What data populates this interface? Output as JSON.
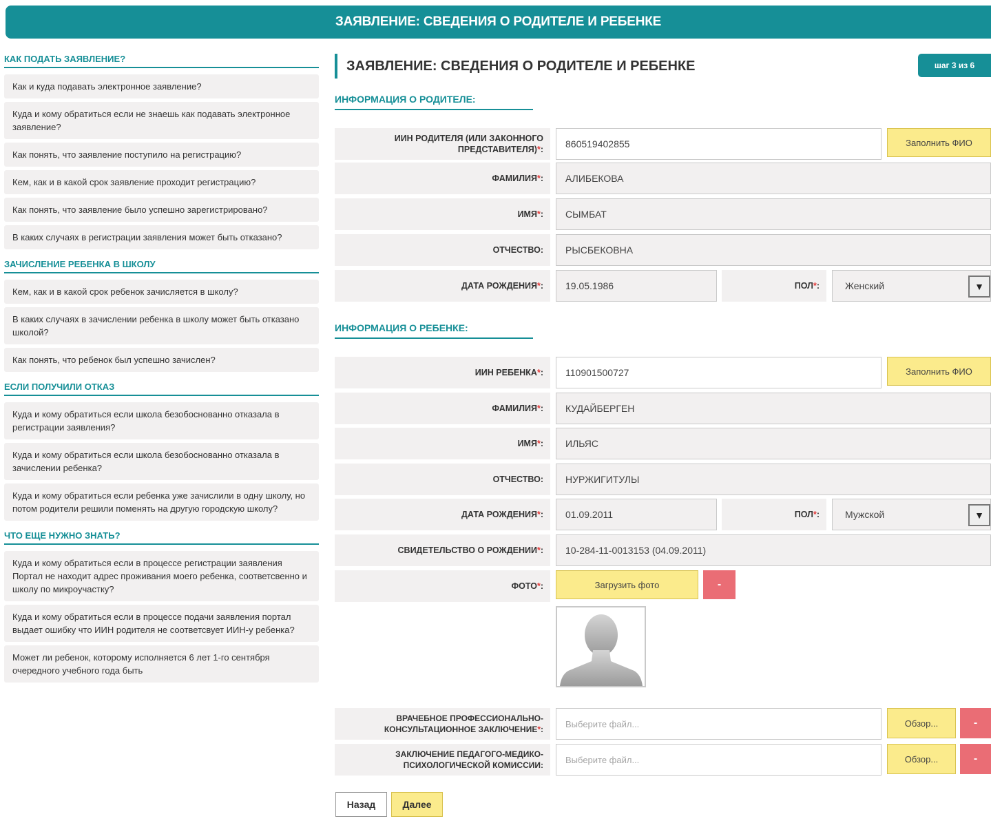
{
  "header": {
    "title": "ЗАЯВЛЕНИЕ: СВЕДЕНИЯ О РОДИТЕЛЕ И РЕБЕНКЕ"
  },
  "sidebar": {
    "sections": [
      {
        "title": "КАК ПОДАТЬ ЗАЯВЛЕНИЕ?",
        "items": [
          "Как и куда подавать электронное заявление?",
          "Куда и кому обратиться если не знаешь как подавать электронное заявление?",
          "Как понять, что заявление поступило на регистрацию?",
          "Кем, как и в какой срок заявление проходит регистрацию?",
          "Как понять, что заявление было успешно зарегистрировано?",
          "В каких случаях в регистрации заявления может быть отказано?"
        ]
      },
      {
        "title": "ЗАЧИСЛЕНИЕ РЕБЕНКА В ШКОЛУ",
        "items": [
          "Кем, как и в какой срок ребенок зачисляется в школу?",
          "В каких случаях в зачислении ребенка в школу может быть отказано школой?",
          "Как понять, что ребенок был успешно зачислен?"
        ]
      },
      {
        "title": "ЕСЛИ ПОЛУЧИЛИ ОТКАЗ",
        "items": [
          "Куда и кому обратиться если школа безобоснованно отказала в регистрации заявления?",
          "Куда и кому обратиться если школа безобоснованно отказала в зачислении ребенка?",
          "Куда и кому обратиться если ребенка уже зачислили в одну школу, но потом родители решили поменять на другую городскую школу?"
        ]
      },
      {
        "title": "ЧТО ЕЩЕ НУЖНО ЗНАТЬ?",
        "items": [
          "Куда и кому обратиться если в процессе регистрации заявления Портал не находит адрес проживания моего ребенка, соответсвенно и школу по микроучастку?",
          "Куда и кому обратиться если в процессе подачи заявления портал выдает ошибку что ИИН родителя не соответсвует ИИН-у ребенка?",
          "Может ли ребенок, которому исполняется 6 лет 1-го сентября очередного учебного года быть"
        ]
      }
    ]
  },
  "main": {
    "title": "ЗАЯВЛЕНИЕ: СВЕДЕНИЯ О РОДИТЕЛЕ И РЕБЕНКЕ",
    "step": "шаг 3 из 6",
    "required_mark": "*",
    "parent": {
      "section_title": "ИНФОРМАЦИЯ О РОДИТЕЛЕ:",
      "iin_label": "ИИН РОДИТЕЛЯ (ИЛИ ЗАКОННОГО ПРЕДСТАВИТЕЛЯ)",
      "iin_value": "860519402855",
      "fill_button": "Заполнить ФИО",
      "surname_label": "ФАМИЛИЯ",
      "surname_value": "АЛИБЕКОВА",
      "name_label": "ИМЯ",
      "name_value": "СЫМБАТ",
      "patronymic_label": "ОТЧЕСТВО:",
      "patronymic_value": "РЫСБЕКОВНА",
      "birth_label": "ДАТА РОЖДЕНИЯ",
      "birth_value": "19.05.1986",
      "gender_label": "ПОЛ",
      "gender_value": "Женский"
    },
    "child": {
      "section_title": "ИНФОРМАЦИЯ О РЕБЕНКЕ:",
      "iin_label": "ИИН РЕБЕНКА",
      "iin_value": "110901500727",
      "fill_button": "Заполнить ФИО",
      "surname_label": "ФАМИЛИЯ",
      "surname_value": "КУДАЙБЕРГЕН",
      "name_label": "ИМЯ",
      "name_value": "ИЛЬЯС",
      "patronymic_label": "ОТЧЕСТВО:",
      "patronymic_value": "НУРЖИГИТУЛЫ",
      "birth_label": "ДАТА РОЖДЕНИЯ",
      "birth_value": "01.09.2011",
      "gender_label": "ПОЛ",
      "gender_value": "Мужской",
      "certificate_label": "СВИДЕТЕЛЬСТВО О РОЖДЕНИИ",
      "certificate_value": "10-284-11-0013153 (04.09.2011)",
      "photo_label": "ФОТО",
      "upload_photo": "Загрузить фото",
      "remove": "-",
      "medical_label": "ВРАЧЕБНОЕ ПРОФЕССИОНАЛЬНО-КОНСУЛЬТАЦИОННОЕ ЗАКЛЮЧЕНИЕ",
      "medical_placeholder": "Выберите файл...",
      "pmpk_label": "ЗАКЛЮЧЕНИЕ ПЕДАГОГО-МЕДИКО-ПСИХОЛОГИЧЕСКОЙ КОМИССИИ:",
      "pmpk_placeholder": "Выберите файл...",
      "browse": "Обзор..."
    },
    "nav": {
      "back": "Назад",
      "next": "Далее"
    }
  },
  "colors": {
    "teal": "#168f97",
    "yellow": "#fbeb8c",
    "red": "#ea6d75",
    "field_bg": "#f2f0f0"
  },
  "icons": {
    "select_arrow": "triangle-down-icon",
    "avatar": "person-silhouette-icon"
  }
}
